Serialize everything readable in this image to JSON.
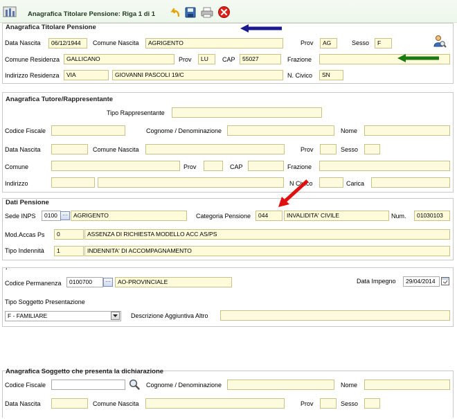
{
  "toolbar": {
    "title": "Anagrafica Titolare Pensione: Riga 1 di 1"
  },
  "titolare": {
    "title": "Anagrafica Titolare Pensione",
    "data_nascita_label": "Data Nascita",
    "data_nascita": "06/12/1944",
    "comune_nascita_label": "Comune Nascita",
    "comune_nascita": "AGRIGENTO",
    "prov_label": "Prov",
    "prov": "AG",
    "sesso_label": "Sesso",
    "sesso": "F",
    "comune_residenza_label": "Comune Residenza",
    "comune_residenza": "GALLICANO",
    "prov_res_label": "Prov",
    "prov_res": "LU",
    "cap_label": "CAP",
    "cap": "55027",
    "frazione_label": "Frazione",
    "frazione": "",
    "indirizzo_label": "Indirizzo Residenza",
    "indirizzo_tipo": "VIA",
    "indirizzo": "GIOVANNI PASCOLI 19/C",
    "civico_label": "N. Civico",
    "civico": "SN"
  },
  "tutore": {
    "title": "Anagrafica Tutore/Rappresentante",
    "tipo_label": "Tipo Rappresentante",
    "cf_label": "Codice Fiscale",
    "cognome_label": "Cognome / Denominazione",
    "nome_label": "Nome",
    "data_nascita_label": "Data Nascita",
    "comune_nascita_label": "Comune Nascita",
    "prov_label": "Prov",
    "sesso_label": "Sesso",
    "comune_label": "Comune",
    "prov2_label": "Prov",
    "cap_label": "CAP",
    "frazione_label": "Frazione",
    "indirizzo_label": "Indirizzo",
    "civico_label": "N Civico",
    "carica_label": "Carica"
  },
  "pensione": {
    "title": "Dati Pensione",
    "sede_label": "Sede INPS",
    "sede_code": "0100",
    "sede_name": "AGRIGENTO",
    "categoria_label": "Categoria Pensione",
    "categoria_code": "044",
    "categoria_name": "INVALIDITA' CIVILE",
    "num_label": "Num.",
    "num": "01030103",
    "mod_label": "Mod.Accas Ps",
    "mod_code": "0",
    "mod_desc": "ASSENZA DI RICHIESTA MODELLO ACC AS/PS",
    "tipo_label": "Tipo Indennità",
    "tipo_code": "1",
    "tipo_desc": "INDENNITA' DI ACCOMPAGNAMENTO"
  },
  "permanenza": {
    "title": ".",
    "codice_label": "Codice Permanenza",
    "codice": "0100700",
    "codice_desc": "AO-PROVINCIALE",
    "data_impegno_label": "Data Impegno",
    "data_impegno": "29/04/2014",
    "tipo_soggetto_label": "Tipo Soggetto Presentazione",
    "tipo_soggetto": "F - FAMILIARE",
    "descrizione_label": "Descrizione Aggiuntiva Altro"
  },
  "soggetto": {
    "title": "Anagrafica Soggetto che presenta la dichiarazione",
    "cf_label": "Codice Fiscale",
    "cognome_label": "Cognome / Denominazione",
    "nome_label": "Nome",
    "data_nascita_label": "Data Nascita",
    "comune_nascita_label": "Comune Nascita",
    "prov_label": "Prov",
    "sesso_label": "Sesso"
  },
  "colors": {
    "field_bg": "#fdfbd9",
    "arrow_blue": "#1b1b8f",
    "arrow_green": "#1a7a12",
    "arrow_red": "#e01010"
  }
}
